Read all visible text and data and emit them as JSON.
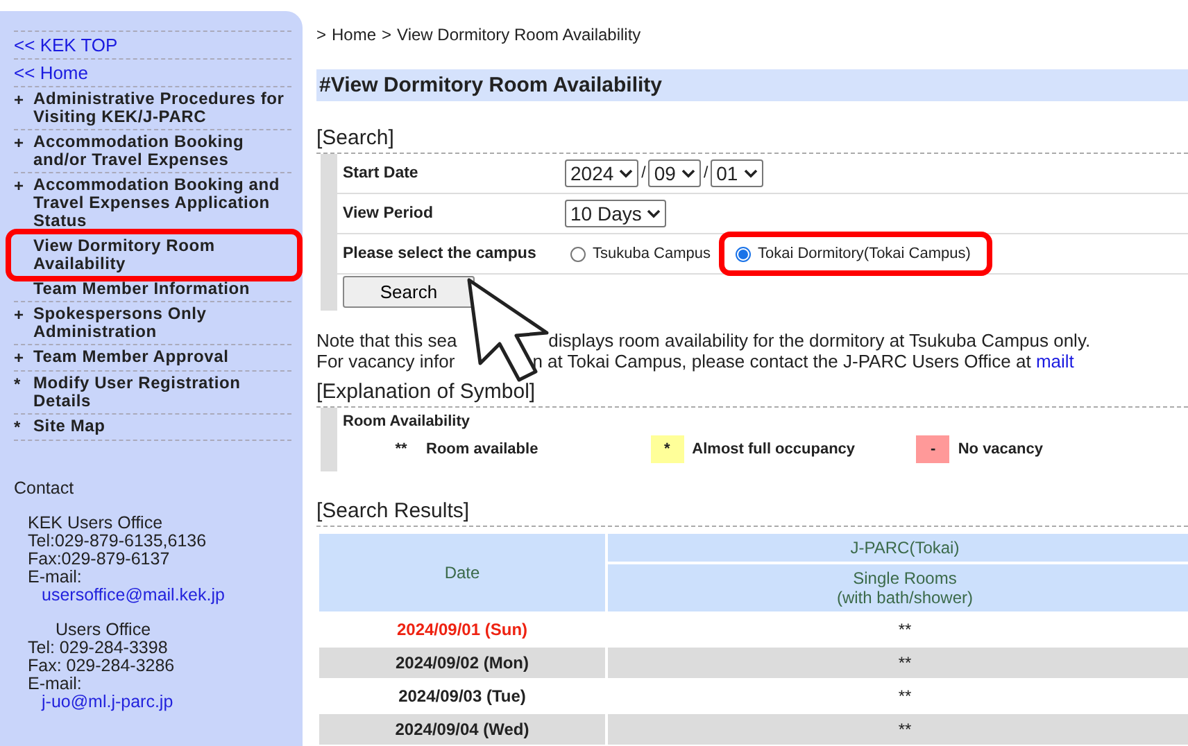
{
  "sidebar": {
    "top_links": [
      {
        "marker": "<<",
        "label": "KEK TOP"
      },
      {
        "marker": "<<",
        "label": "Home"
      }
    ],
    "items": [
      {
        "marker": "+",
        "label": "Administrative Procedures for Visiting KEK/J-PARC",
        "highlighted": false
      },
      {
        "marker": "+",
        "label": "Accommodation Booking and/or Travel Expenses",
        "highlighted": false
      },
      {
        "marker": "+",
        "label": "Accommodation Booking and Travel Expenses Application Status",
        "highlighted": false
      },
      {
        "label": "View Dormitory Room Availability",
        "highlighted": true
      },
      {
        "label": "Team Member Information",
        "highlighted": false
      },
      {
        "marker": "+",
        "label": "Spokespersons Only Administration",
        "highlighted": false
      },
      {
        "marker": "+",
        "label": "Team Member Approval",
        "highlighted": false
      },
      {
        "marker": "*",
        "label": "Modify User Registration Details",
        "highlighted": false
      },
      {
        "marker": "*",
        "label": "Site Map",
        "highlighted": false
      }
    ],
    "contact": {
      "title": "Contact",
      "offices": [
        {
          "name": "KEK Users Office",
          "lines": [
            "Tel:029-879-6135,6136",
            "Fax:029-879-6137",
            "E-mail:"
          ],
          "email": "usersoffice@mail.kek.jp"
        },
        {
          "name": "Users Office",
          "lines": [
            "Tel: 029-284-3398",
            "Fax: 029-284-3286",
            "E-mail:"
          ],
          "email": "j-uo@ml.j-parc.jp"
        }
      ]
    }
  },
  "breadcrumb": {
    "separator": ">",
    "items": [
      "Home",
      "View Dormitory Room Availability"
    ]
  },
  "page_title": "#View Dormitory Room Availability",
  "search": {
    "heading": "[Search]",
    "start_date": {
      "label": "Start Date",
      "year": "2024",
      "month": "09",
      "day": "01",
      "separator": "/"
    },
    "view_period": {
      "label": "View Period",
      "value": "10 Days"
    },
    "campus": {
      "label": "Please select the campus",
      "options": [
        {
          "label": "Tsukuba Campus",
          "selected": false,
          "highlighted": false
        },
        {
          "label": "Tokai Dormitory(Tokai Campus)",
          "selected": true,
          "highlighted": true
        }
      ]
    },
    "button": "Search"
  },
  "note": {
    "line_1": [
      "Note that this sea",
      "displays room availability for the dormitory at Tsukuba Campus only."
    ],
    "line_2": [
      "For vacancy infor",
      "n at Tokai Campus, please contact the J-PARC Users Office at"
    ],
    "link": "mailt"
  },
  "legend": {
    "heading": "[Explanation of Symbol]",
    "title": "Room Availability",
    "items": [
      {
        "kind": "available",
        "symbol": "**",
        "label": "Room available"
      },
      {
        "kind": "almost_full",
        "symbol": "*",
        "label": "Almost full occupancy"
      },
      {
        "kind": "no_vacancy",
        "symbol": "-",
        "label": "No vacancy"
      }
    ]
  },
  "results": {
    "heading": "[Search Results]",
    "date_header": "Date",
    "group_header": "J-PARC(Tokai)",
    "room_header": [
      "Single Rooms",
      "(with bath/shower)"
    ],
    "rows": [
      {
        "date": "2024/09/01 (Sun)",
        "holiday": true,
        "value": "**"
      },
      {
        "date": "2024/09/02 (Mon)",
        "holiday": false,
        "value": "**"
      },
      {
        "date": "2024/09/03 (Tue)",
        "holiday": false,
        "value": "**"
      },
      {
        "date": "2024/09/04 (Wed)",
        "holiday": false,
        "value": "**"
      }
    ]
  }
}
